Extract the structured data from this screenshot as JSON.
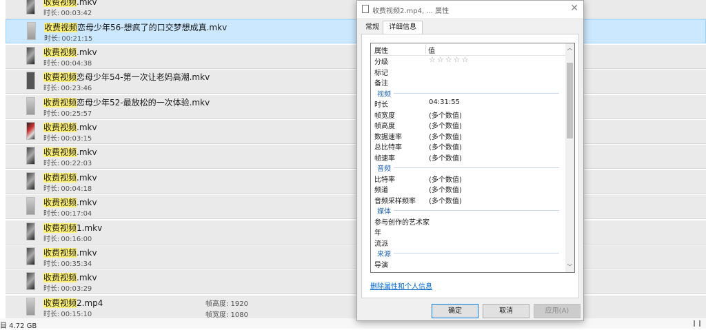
{
  "files": [
    {
      "prefix": "收费视频",
      "rest": ".mkv",
      "duration_label": "时长:",
      "duration": "00:03:42",
      "thumb": "pic"
    },
    {
      "prefix": "收费视频",
      "rest": "恋母少年56-想疯了的口交梦想成真.mkv",
      "duration_label": "时长:",
      "duration": "00:21:15",
      "thumb": "light",
      "selected": true
    },
    {
      "prefix": "收费视频",
      "rest": ".mkv",
      "duration_label": "时长:",
      "duration": "00:04:38",
      "thumb": "pic"
    },
    {
      "prefix": "收费视频",
      "rest": "恋母少年54-第一次让老妈高潮.mkv",
      "duration_label": "时长:",
      "duration": "00:23:46",
      "thumb": "dark"
    },
    {
      "prefix": "收费视频",
      "rest": "恋母少年52-最放松的一次体验.mkv",
      "duration_label": "时长:",
      "duration": "00:25:57",
      "thumb": "light"
    },
    {
      "prefix": "收费视频",
      "rest": ".mkv",
      "duration_label": "时长:",
      "duration": "00:03:15",
      "thumb": "red"
    },
    {
      "prefix": "收费视频",
      "rest": ".mkv",
      "duration_label": "时长:",
      "duration": "00:22:03",
      "thumb": "pic"
    },
    {
      "prefix": "收费视频",
      "rest": ".mkv",
      "duration_label": "时长:",
      "duration": "00:04:18",
      "thumb": "pic"
    },
    {
      "prefix": "收费视频",
      "rest": ".mkv",
      "duration_label": "时长:",
      "duration": "00:17:04",
      "thumb": "light"
    },
    {
      "prefix": "收费视频",
      "rest": "1.mkv",
      "duration_label": "时长:",
      "duration": "00:16:00",
      "thumb": "pic"
    },
    {
      "prefix": "收费视频",
      "rest": ".mkv",
      "duration_label": "时长:",
      "duration": "00:35:34",
      "thumb": "pic"
    },
    {
      "prefix": "收费视频",
      "rest": ".mkv",
      "duration_label": "时长:",
      "duration": "00:03:29",
      "thumb": "pic"
    },
    {
      "prefix": "收费视频",
      "rest": "2.mp4",
      "duration_label": "时长:",
      "duration": "00:15:10",
      "thumb": "light",
      "frame_height": "帧高度: 1920",
      "frame_width": "帧宽度: 1080"
    }
  ],
  "statusbar": {
    "text": "目  4.72 GB"
  },
  "dialog": {
    "title": "收费视频2.mp4, ... 属性",
    "tabs": [
      "常规",
      "详细信息"
    ],
    "header": {
      "col1": "属性",
      "col2": "值"
    },
    "rows": [
      {
        "k": "分级",
        "v": "☆☆☆☆☆",
        "stars": true
      },
      {
        "k": "标记",
        "v": ""
      },
      {
        "k": "备注",
        "v": ""
      },
      {
        "section": "视频"
      },
      {
        "k": "时长",
        "v": "04:31:55"
      },
      {
        "k": "帧宽度",
        "v": "(多个数值)"
      },
      {
        "k": "帧高度",
        "v": "(多个数值)"
      },
      {
        "k": "数据速率",
        "v": "(多个数值)"
      },
      {
        "k": "总比特率",
        "v": "(多个数值)"
      },
      {
        "k": "帧速率",
        "v": "(多个数值)"
      },
      {
        "section": "音频"
      },
      {
        "k": "比特率",
        "v": "(多个数值)"
      },
      {
        "k": "频道",
        "v": "(多个数值)"
      },
      {
        "k": "音频采样频率",
        "v": "(多个数值)"
      },
      {
        "section": "媒体"
      },
      {
        "k": "参与创作的艺术家",
        "v": ""
      },
      {
        "k": "年",
        "v": ""
      },
      {
        "k": "流派",
        "v": ""
      },
      {
        "section": "来源"
      },
      {
        "k": "导演",
        "v": ""
      }
    ],
    "remove_link": "删除属性和个人信息",
    "buttons": {
      "ok": "确定",
      "cancel": "取消",
      "apply": "应用(A)"
    }
  }
}
